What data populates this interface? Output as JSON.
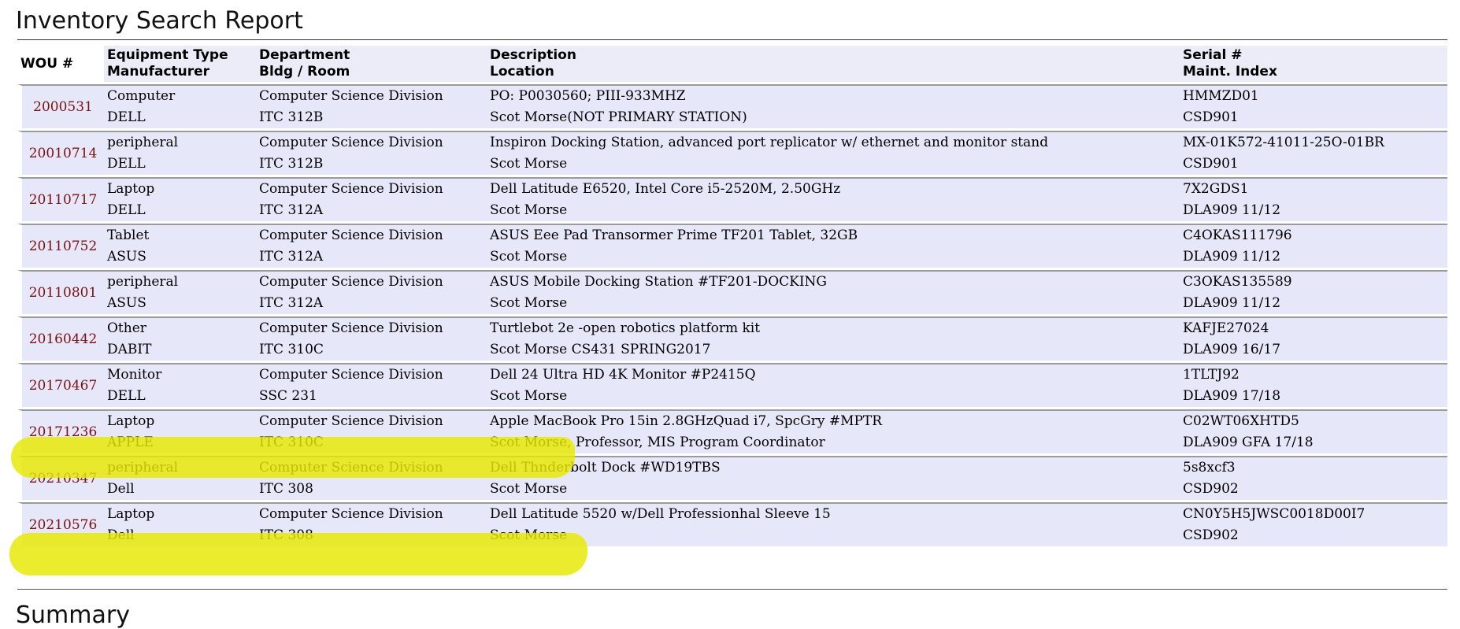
{
  "report": {
    "title": "Inventory Search Report",
    "summary_heading": "Summary"
  },
  "columns": {
    "wou": "WOU #",
    "type": "Equipment Type",
    "manufacturer": "Manufacturer",
    "department": "Department",
    "bldg_room": "Bldg / Room",
    "description": "Description",
    "location": "Location",
    "serial": "Serial #",
    "maint_index": "Maint. Index"
  },
  "rows": [
    {
      "wou": "2000531",
      "type": "Computer",
      "manufacturer": "DELL",
      "department": "Computer Science Division",
      "bldg_room": "ITC 312B",
      "description": "PO: P0030560; PIII-933MHZ",
      "location": "Scot Morse(NOT PRIMARY STATION)",
      "serial": "HMMZD01",
      "maint_index": "CSD901",
      "highlighted": false
    },
    {
      "wou": "20010714",
      "type": "peripheral",
      "manufacturer": "DELL",
      "department": "Computer Science Division",
      "bldg_room": "ITC 312B",
      "description": "Inspiron Docking Station, advanced port replicator w/ ethernet and monitor stand",
      "location": "Scot Morse",
      "serial": "MX-01K572-41011-25O-01BR",
      "maint_index": "CSD901",
      "highlighted": false
    },
    {
      "wou": "20110717",
      "type": "Laptop",
      "manufacturer": "DELL",
      "department": "Computer Science Division",
      "bldg_room": "ITC 312A",
      "description": "Dell Latitude E6520, Intel Core i5-2520M, 2.50GHz",
      "location": "Scot Morse",
      "serial": "7X2GDS1",
      "maint_index": "DLA909 11/12",
      "highlighted": false
    },
    {
      "wou": "20110752",
      "type": "Tablet",
      "manufacturer": "ASUS",
      "department": "Computer Science Division",
      "bldg_room": "ITC 312A",
      "description": "ASUS Eee Pad Transormer Prime TF201 Tablet, 32GB",
      "location": "Scot Morse",
      "serial": "C4OKAS111796",
      "maint_index": "DLA909 11/12",
      "highlighted": false
    },
    {
      "wou": "20110801",
      "type": "peripheral",
      "manufacturer": "ASUS",
      "department": "Computer Science Division",
      "bldg_room": "ITC 312A",
      "description": "ASUS Mobile Docking Station #TF201-DOCKING",
      "location": "Scot Morse",
      "serial": "C3OKAS135589",
      "maint_index": "DLA909 11/12",
      "highlighted": false
    },
    {
      "wou": "20160442",
      "type": "Other",
      "manufacturer": "DABIT",
      "department": "Computer Science Division",
      "bldg_room": "ITC 310C",
      "description": "Turtlebot 2e -open robotics platform kit",
      "location": "Scot Morse CS431 SPRING2017",
      "serial": "KAFJE27024",
      "maint_index": "DLA909 16/17",
      "highlighted": false
    },
    {
      "wou": "20170467",
      "type": "Monitor",
      "manufacturer": "DELL",
      "department": "Computer Science Division",
      "bldg_room": "SSC 231",
      "description": "Dell 24 Ultra HD 4K Monitor #P2415Q",
      "location": "Scot Morse",
      "serial": "1TLTJ92",
      "maint_index": "DLA909 17/18",
      "highlighted": false
    },
    {
      "wou": "20171236",
      "type": "Laptop",
      "manufacturer": "APPLE",
      "department": "Computer Science Division",
      "bldg_room": "ITC 310C",
      "description": "Apple MacBook Pro 15in 2.8GHzQuad i7, SpcGry #MPTR",
      "location": "Scot Morse, Professor, MIS Program Coordinator",
      "serial": "C02WT06XHTD5",
      "maint_index": "DLA909 GFA 17/18",
      "highlighted": true
    },
    {
      "wou": "20210347",
      "type": "peripheral",
      "manufacturer": "Dell",
      "department": "Computer Science Division",
      "bldg_room": "ITC 308",
      "description": "Dell Thnderbolt Dock #WD19TBS",
      "location": "Scot Morse",
      "serial": "5s8xcf3",
      "maint_index": "CSD902",
      "highlighted": false
    },
    {
      "wou": "20210576",
      "type": "Laptop",
      "manufacturer": "Dell",
      "department": "Computer Science Division",
      "bldg_room": "ITC 308",
      "description": "Dell Latitude 5520 w/Dell Professionhal Sleeve 15",
      "location": "Scot Morse",
      "serial": "CN0Y5H5JWSC0018D00I7",
      "maint_index": "CSD902",
      "highlighted": true
    }
  ],
  "colors": {
    "row_background": "#e7e7fa",
    "header_background": "#ececf9",
    "wou_link": "#7a1010",
    "highlighter": "#e8e800"
  }
}
